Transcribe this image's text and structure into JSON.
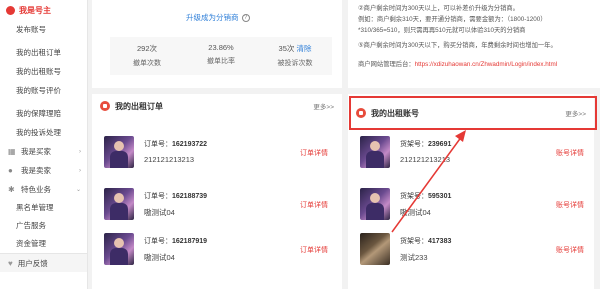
{
  "sidebar": {
    "header": "我是号主",
    "items": [
      {
        "label": "发布账号"
      },
      {
        "label": "我的出租订单"
      },
      {
        "label": "我的出租账号"
      },
      {
        "label": "我的账号评价"
      },
      {
        "label": "我的保障理赔"
      },
      {
        "label": "我的投诉处理"
      }
    ],
    "group_buyer": "我是买家",
    "group_seller": "我是卖家",
    "group_special": "特色业务",
    "special_items": [
      {
        "label": "黑名单管理"
      },
      {
        "label": "广告服务"
      },
      {
        "label": "资金管理"
      }
    ],
    "footer": "用户反馈"
  },
  "top_left": {
    "upgrade_link": "升级成为分销商",
    "stats": [
      {
        "value": "292次",
        "label": "撤单次数",
        "link": ""
      },
      {
        "value": "23.86%",
        "label": "撤单比率",
        "link": ""
      },
      {
        "value": "35次",
        "label": "被投诉次数",
        "link": "清除"
      }
    ]
  },
  "top_right": {
    "line1": "②商户剩余时间为300天以上，可以补差价升级为分销商。",
    "line2": "例如：商户剩余310天，要开通分销商，需要金额为：（1800-1200）",
    "line3": "*310/365=510，则只需再再510元就可以体验310天的分销商",
    "line4": "⑤商户剩余时间为300天以下，购买分销商，年费剩余时间也增加一年。",
    "line5_label": "商户网站管理后台：",
    "line5_url": "https://xdizuhaowan.cn/Zhwadmin/Login/index.html"
  },
  "orders_panel": {
    "title": "我的出租订单",
    "more": "更多>>",
    "rows": [
      {
        "id_label": "订单号：",
        "id": "162193722",
        "desc": "212121213213",
        "link": "订单详情",
        "thumb": "hero"
      },
      {
        "id_label": "订单号：",
        "id": "162188739",
        "desc": "嗷测试04",
        "link": "订单详情",
        "thumb": "hero"
      },
      {
        "id_label": "订单号：",
        "id": "162187919",
        "desc": "嗷测试04",
        "link": "订单详情",
        "thumb": "hero"
      }
    ]
  },
  "accounts_panel": {
    "title": "我的出租账号",
    "more": "更多>>",
    "rows": [
      {
        "id_label": "货架号：",
        "id": "239691",
        "desc": "212121213213",
        "link": "账号详情",
        "thumb": "hero"
      },
      {
        "id_label": "货架号：",
        "id": "595301",
        "desc": "嗷测试04",
        "link": "账号详情",
        "thumb": "hero"
      },
      {
        "id_label": "货架号：",
        "id": "417383",
        "desc": "测试233",
        "link": "账号详情",
        "thumb": "dark"
      }
    ]
  },
  "colors": {
    "accent_red": "#e53935",
    "link_blue": "#2f7fd8"
  }
}
